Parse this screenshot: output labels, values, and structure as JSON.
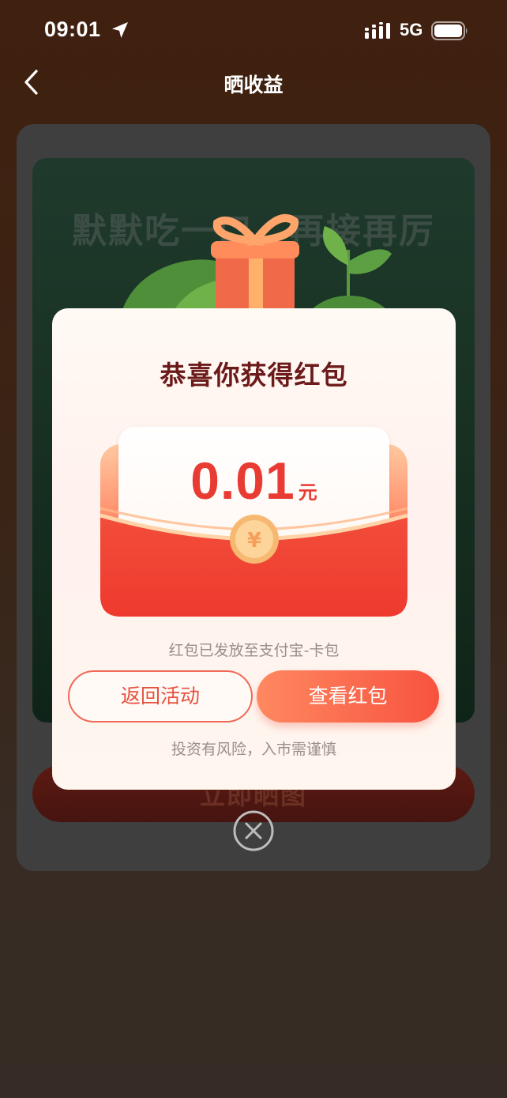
{
  "status_bar": {
    "time": "09:01",
    "network": "5G"
  },
  "nav": {
    "title": "晒收益"
  },
  "poster": {
    "title": "默默吃一口，再接再厉",
    "share_button_label": "立即晒图"
  },
  "modal": {
    "title": "恭喜你获得红包",
    "amount_value": "0.01",
    "amount_unit": "元",
    "sent_note": "红包已发放至支付宝-卡包",
    "back_button_label": "返回活动",
    "view_button_label": "查看红包",
    "risk_note": "投资有风险，入市需谨慎",
    "seal_symbol": "¥"
  },
  "colors": {
    "accent_red": "#e83b33",
    "button_gradient_start": "#ff8860",
    "button_gradient_end": "#f7533f",
    "title_dark_red": "#6b1a1a",
    "page_background_top": "#40200f"
  },
  "icons": [
    "location-arrow-icon",
    "signal-icon",
    "battery-icon",
    "back-chevron-icon",
    "close-icon",
    "gift-box-icon",
    "yuan-seal-icon",
    "leaf-icon"
  ]
}
